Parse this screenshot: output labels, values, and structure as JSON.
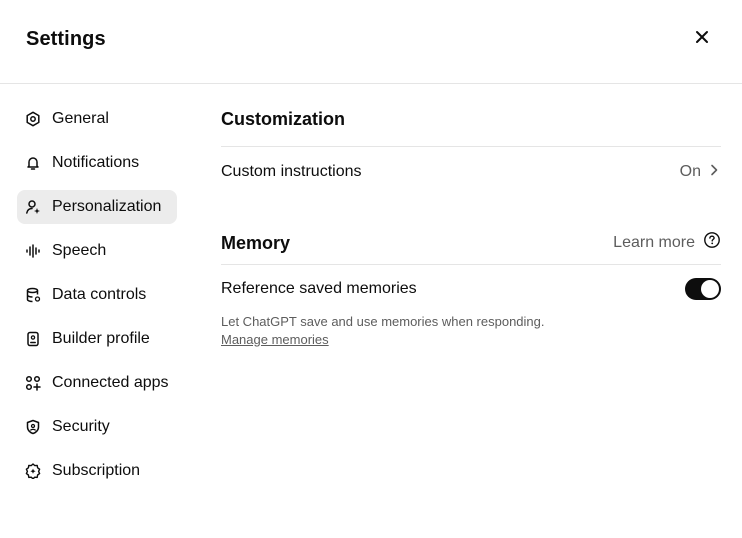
{
  "dialog": {
    "title": "Settings",
    "close_icon": "close-icon"
  },
  "sidebar": {
    "items": [
      {
        "label": "General",
        "icon": "gear-icon",
        "active": false
      },
      {
        "label": "Notifications",
        "icon": "bell-icon",
        "active": false
      },
      {
        "label": "Personalization",
        "icon": "person-sparkle-icon",
        "active": true
      },
      {
        "label": "Speech",
        "icon": "waveform-icon",
        "active": false
      },
      {
        "label": "Data controls",
        "icon": "database-icon",
        "active": false
      },
      {
        "label": "Builder profile",
        "icon": "id-badge-icon",
        "active": false
      },
      {
        "label": "Connected apps",
        "icon": "apps-grid-icon",
        "active": false
      },
      {
        "label": "Security",
        "icon": "shield-icon",
        "active": false
      },
      {
        "label": "Subscription",
        "icon": "badge-icon",
        "active": false
      }
    ]
  },
  "main": {
    "customization": {
      "title": "Customization",
      "custom_instructions_label": "Custom instructions",
      "custom_instructions_value": "On"
    },
    "memory": {
      "title": "Memory",
      "learn_more": "Learn more",
      "reference_label": "Reference saved memories",
      "reference_enabled": true,
      "description": "Let ChatGPT save and use memories when responding.",
      "manage_link": "Manage memories"
    }
  },
  "colors": {
    "active_nav_bg": "#ececec",
    "toggle_on": "#0d0d0d",
    "muted_text": "#5d5d5d",
    "divider": "#e5e5e5"
  }
}
